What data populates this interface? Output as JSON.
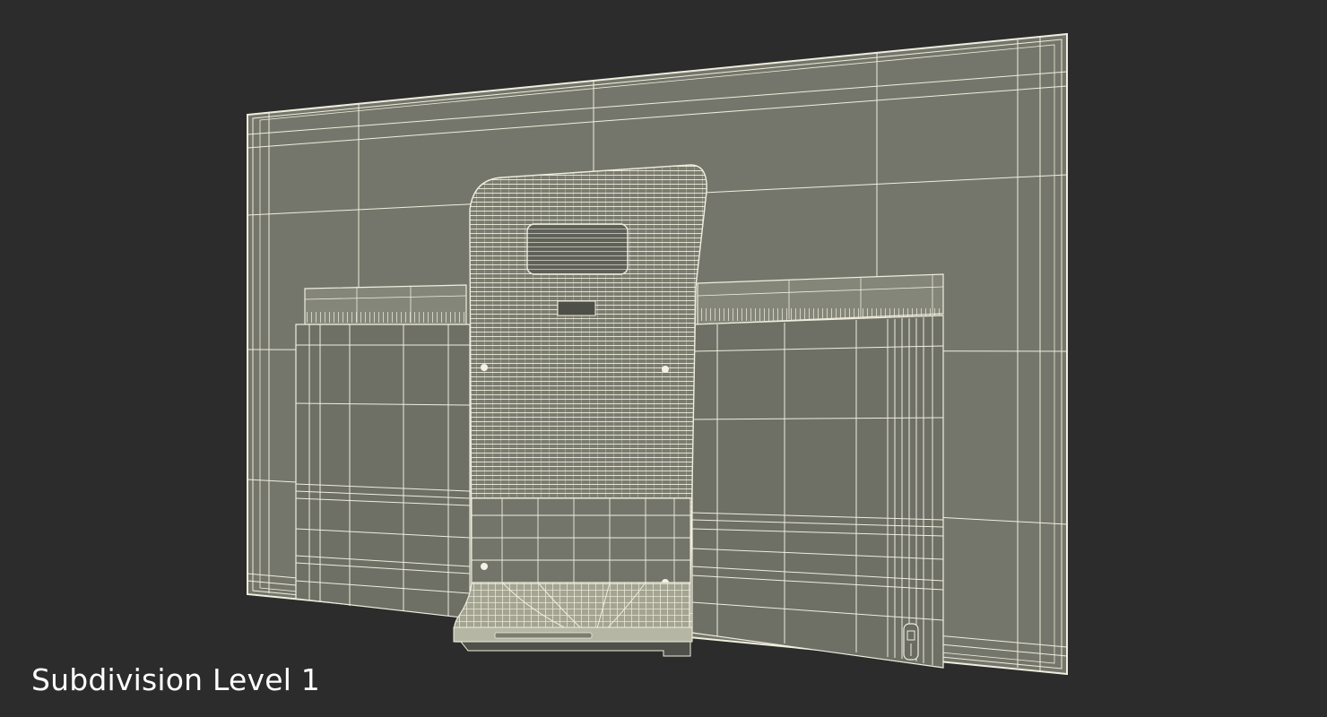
{
  "viewport": {
    "caption": "Subdivision Level 1"
  },
  "colors": {
    "background": "#2c2c2c",
    "panel_fill": "#75766b",
    "panel_dark": "#62635a",
    "wire": "#efeede",
    "wire_dense": "#e8e7d4"
  },
  "model": {
    "name": "tv-back-wireframe",
    "render_mode": "wireframe-on-shaded"
  }
}
